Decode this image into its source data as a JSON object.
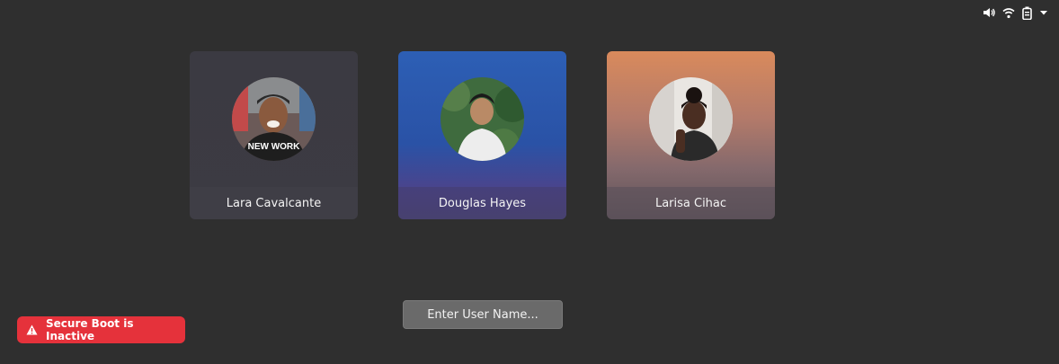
{
  "tray": {
    "icons": [
      "volume-icon",
      "wifi-icon",
      "battery-icon",
      "dropdown-arrow-icon"
    ]
  },
  "users": [
    {
      "name": "Lara Cavalcante",
      "avatar_text": "NEW WORK"
    },
    {
      "name": "Douglas Hayes"
    },
    {
      "name": "Larisa Cihac"
    }
  ],
  "username_entry": {
    "label": "Enter User Name..."
  },
  "secure_boot": {
    "icon": "warning-icon",
    "label": "Secure Boot is Inactive",
    "color": "#e5323b"
  }
}
